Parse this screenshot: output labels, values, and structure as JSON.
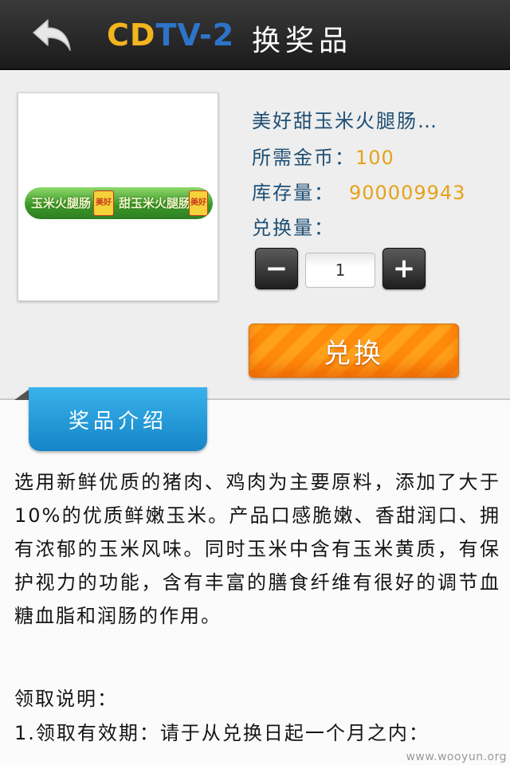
{
  "header": {
    "logo_part1": "CD",
    "logo_part2": "TV-2",
    "title": "换奖品"
  },
  "product": {
    "image_labels": {
      "stripe1": "玉米火腿肠",
      "brand1": "美好",
      "stripe2": "甜玉米火腿肠",
      "brand2": "美好"
    },
    "name": "美好甜玉米火腿肠…",
    "cost_label": "所需金币：",
    "cost_value": "100",
    "stock_label": "库存量：",
    "stock_value": "900009943",
    "qty_label": "兑换量：",
    "qty_value": "1",
    "minus_symbol": "−",
    "plus_symbol": "+",
    "redeem_label": "兑换"
  },
  "description": {
    "tab_label": "奖品介绍",
    "text": "选用新鲜优质的猪肉、鸡肉为主要原料，添加了大于10%的优质鲜嫩玉米。产品口感脆嫩、香甜润口、拥有浓郁的玉米风味。同时玉米中含有玉米黄质，有保护视力的功能，含有丰富的膳食纤维有很好的调节血糖血脂和润肠的作用。",
    "howto_title": "领取说明：",
    "howto_line1": "1.领取有效期：请于从兑换日起一个月之内："
  },
  "watermark": "www.wooyun.org",
  "colors": {
    "header_bg": "#1b1b1b",
    "accent_blue": "#1585c8",
    "accent_orange": "#ff8c0a",
    "value_gold": "#e5a21a",
    "label_blue": "#1e4f74"
  }
}
